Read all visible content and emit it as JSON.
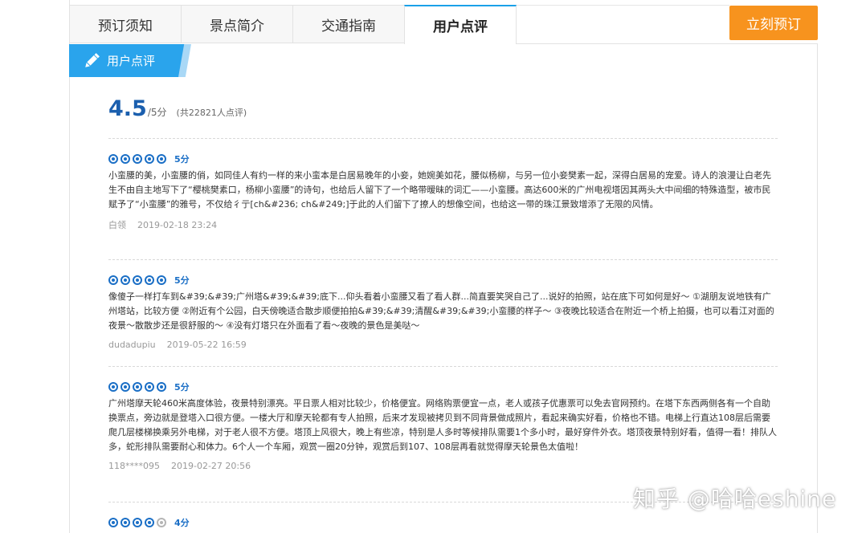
{
  "tabs": [
    {
      "label": "预订须知",
      "active": false
    },
    {
      "label": "景点简介",
      "active": false
    },
    {
      "label": "交通指南",
      "active": false
    },
    {
      "label": "用户点评",
      "active": true
    }
  ],
  "book_button": "立刻预订",
  "section_title": "用户点评",
  "rating": {
    "score": "4.5",
    "max": "/5分",
    "count": "(共22821人点评)"
  },
  "reviews": [
    {
      "stars": 5,
      "score_label": "5分",
      "text": "小蛮腰的美，小蛮腰的俏，如同佳人有约一样的来小蛮本是白居易晚年的小妾，她婉美如花，腰似杨柳，与另一位小妾樊素一起，深得白居易的宠爱。诗人的浪漫让白老先生不由自主地写下了“樱桃樊素口，杨柳小蛮腰”的诗句，也给后人留下了一个略带暧昧的词汇——小蛮腰。高达600米的广州电视塔因其两头大中间细的特殊造型，被市民赋予了“小蛮腰”的雅号，不仅给彳亍[ch&#236; ch&#249;]于此的人们留下了撩人的想像空间，也给这一带的珠江景致增添了无限的风情。",
      "user": "白领",
      "date": "2019-02-18 23:24"
    },
    {
      "stars": 5,
      "score_label": "5分",
      "text": "像傻子一样打车到&#39;&#39;广州塔&#39;&#39;底下...仰头看着小蛮腰又看了看人群...简直要笑哭自己了...说好的拍照，站在底下可如何是好～ ①湖朋友说地铁有广州塔站，比较方便 ②附近有个公园，白天傍晚适合散步顺便拍拍&#39;&#39;清醒&#39;&#39;小蛮腰的样子～ ③夜晚比较适合在附近一个桥上拍摄，也可以看江对面的夜景～散散步还是很舒服的～ ④没有灯塔只在外面看了看～夜晚的景色是美哒～",
      "user": "dudadupiu",
      "date": "2019-05-22 16:59"
    },
    {
      "stars": 5,
      "score_label": "5分",
      "text": "广州塔摩天轮460米高度体验，夜景特别漂亮。平日票人相对比较少，价格便宜。网络购票便宜一点，老人或孩子优惠票可以免去官网预约。在塔下东西两侧各有一个自助换票点，旁边就是登塔入口很方便。一楼大厅和摩天轮都有专人拍照，后来才发现被拷贝到不同背景做成照片，看起来确实好看，价格也不错。电梯上行直达108层后需要爬几层楼梯换乘另外电梯，对于老人很不方便。塔顶上风很大，晚上有些凉，特别是人多时等候排队需要1个多小时，最好穿件外衣。塔顶夜景特别好看，值得一看！排队人多，蛇形排队需要耐心和体力。6个人一个车厢，观赏一圈20分钟，观赏后到107、108层再看就觉得摩天轮景色太值啦！",
      "user": "118****095",
      "date": "2019-02-27 20:56"
    },
    {
      "stars": 4,
      "score_label": "4分",
      "text": "",
      "user": "",
      "date": ""
    }
  ],
  "watermark": "知乎 @哈哈eshine",
  "colors": {
    "accent": "#2aa4ec",
    "book": "#f7931e",
    "score": "#1b5fae",
    "star": "#1b6fc6"
  }
}
